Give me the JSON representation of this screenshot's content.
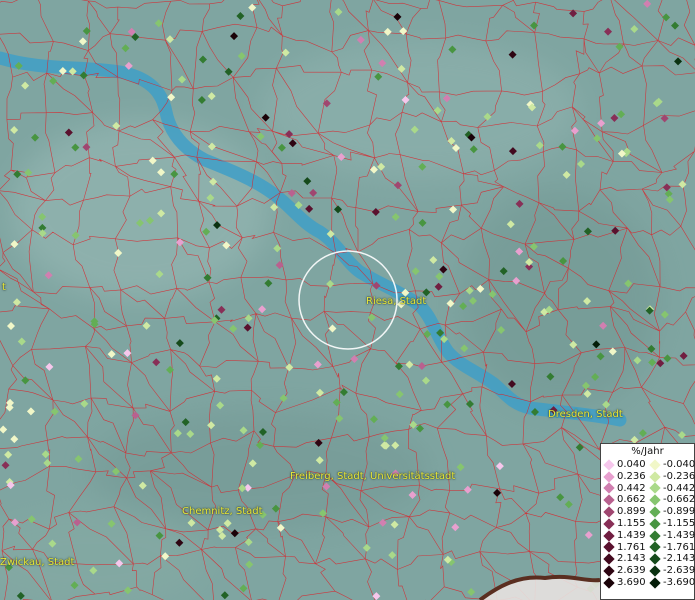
{
  "legend": {
    "title": "%/Jahr",
    "positive": [
      {
        "label": "0.040",
        "color": "#f6c7ec"
      },
      {
        "label": "0.236",
        "color": "#e8a0cf"
      },
      {
        "label": "0.442",
        "color": "#d17fb0"
      },
      {
        "label": "0.662",
        "color": "#b9618f"
      },
      {
        "label": "0.899",
        "color": "#a04670"
      },
      {
        "label": "1.155",
        "color": "#882f57"
      },
      {
        "label": "1.439",
        "color": "#711e41"
      },
      {
        "label": "1.761",
        "color": "#5a112e"
      },
      {
        "label": "2.143",
        "color": "#430a1f"
      },
      {
        "label": "2.639",
        "color": "#2e0512"
      },
      {
        "label": "3.690",
        "color": "#1a0208"
      }
    ],
    "negative": [
      {
        "label": "-0.040",
        "color": "#f1f7c8"
      },
      {
        "label": "-0.236",
        "color": "#cfe9a3"
      },
      {
        "label": "-0.442",
        "color": "#a9d98a"
      },
      {
        "label": "-0.662",
        "color": "#86c56f"
      },
      {
        "label": "-0.899",
        "color": "#63ae55"
      },
      {
        "label": "-1.155",
        "color": "#489541"
      },
      {
        "label": "-1.439",
        "color": "#337c32"
      },
      {
        "label": "-1.761",
        "color": "#226226"
      },
      {
        "label": "-2.143",
        "color": "#154a1b"
      },
      {
        "label": "-2.639",
        "color": "#0b3211"
      },
      {
        "label": "-3.690",
        "color": "#041d08"
      }
    ]
  },
  "places": {
    "riesa": "Riesa, Stadt",
    "dresden": "Dresden, Stadt",
    "freiberg": "Freiberg, Stadt, Universitätsstadt",
    "chemnitz": "Chemnitz, Stadt",
    "zwickau": "Zwickau, Stadt",
    "left_edge": "t"
  },
  "colors": {
    "background": "#7fa5a1",
    "river": "#3f9fc7",
    "boundaries": "#d8242c",
    "highlight_circle": "#ffffff"
  }
}
